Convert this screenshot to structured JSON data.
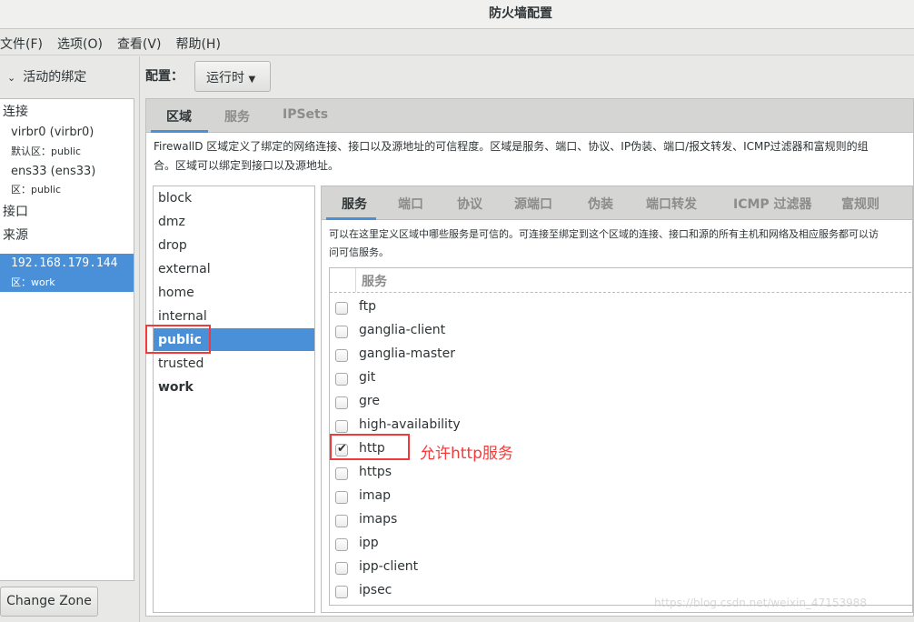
{
  "window": {
    "title": "防火墙配置"
  },
  "menu": [
    "文件(F)",
    "选项(O)",
    "查看(V)",
    "帮助(H)"
  ],
  "bindings": {
    "header": "活动的绑定",
    "connections_label": "连接",
    "connections": [
      {
        "name": "virbr0 (virbr0)",
        "zone": "默认区：public"
      },
      {
        "name": "ens33 (ens33)",
        "zone": "区：public"
      }
    ],
    "interfaces_label": "接口",
    "sources_label": "来源",
    "sources": [
      {
        "name": "192.168.179.144",
        "zone": "区：work",
        "selected": true
      }
    ],
    "change_zone": "Change Zone"
  },
  "config": {
    "label": "配置：",
    "value": "运行时"
  },
  "main_tabs": [
    {
      "label": "区域",
      "active": true
    },
    {
      "label": "服务"
    },
    {
      "label": "IPSets"
    }
  ],
  "zone_description": [
    "FirewallD 区域定义了绑定的网络连接、接口以及源地址的可信程度。区域是服务、端口、协议、IP伪装、端口/报文转发、ICMP过滤器和富规则的组",
    "合。区域可以绑定到接口以及源地址。"
  ],
  "zones": [
    {
      "name": "block"
    },
    {
      "name": "dmz"
    },
    {
      "name": "drop"
    },
    {
      "name": "external"
    },
    {
      "name": "home"
    },
    {
      "name": "internal"
    },
    {
      "name": "public",
      "selected": true
    },
    {
      "name": "trusted"
    },
    {
      "name": "work",
      "bold": true
    }
  ],
  "zone_tabs": [
    {
      "label": "服务",
      "active": true
    },
    {
      "label": "端口"
    },
    {
      "label": "协议"
    },
    {
      "label": "源端口"
    },
    {
      "label": "伪装"
    },
    {
      "label": "端口转发"
    },
    {
      "label": "ICMP 过滤器"
    },
    {
      "label": "富规则"
    }
  ],
  "service_description": [
    "可以在这里定义区域中哪些服务是可信的。可连接至绑定到这个区域的连接、接口和源的所有主机和网络及相应服务都可以访",
    "问可信服务。"
  ],
  "services_header": "服务",
  "services": [
    {
      "name": "ftp",
      "checked": false
    },
    {
      "name": "ganglia-client",
      "checked": false
    },
    {
      "name": "ganglia-master",
      "checked": false
    },
    {
      "name": "git",
      "checked": false
    },
    {
      "name": "gre",
      "checked": false
    },
    {
      "name": "high-availability",
      "checked": false
    },
    {
      "name": "http",
      "checked": true
    },
    {
      "name": "https",
      "checked": false
    },
    {
      "name": "imap",
      "checked": false
    },
    {
      "name": "imaps",
      "checked": false
    },
    {
      "name": "ipp",
      "checked": false
    },
    {
      "name": "ipp-client",
      "checked": false
    },
    {
      "name": "ipsec",
      "checked": false
    }
  ],
  "annotation": "允许http服务",
  "watermark": "https://blog.csdn.net/weixin_47153988",
  "colors": {
    "accent": "#4a90d9",
    "annotation": "#f23a3a"
  }
}
